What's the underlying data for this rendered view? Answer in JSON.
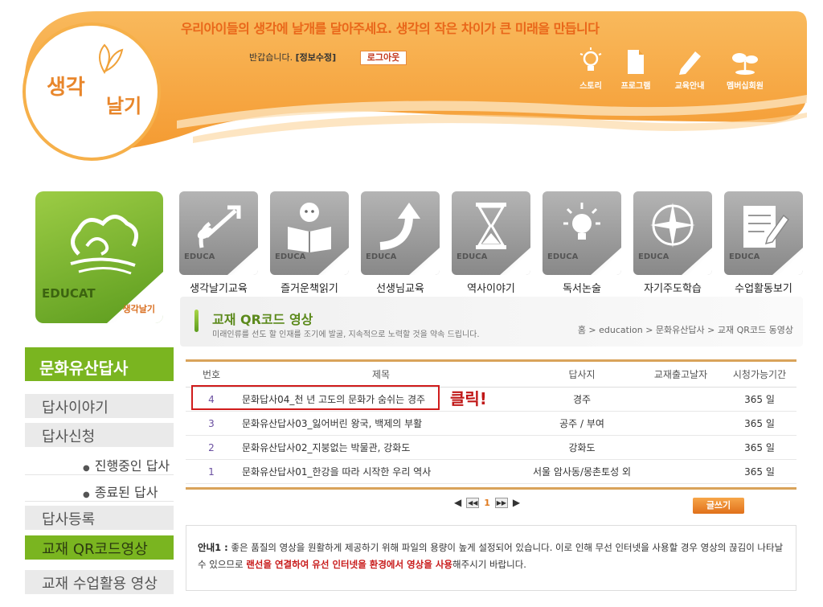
{
  "header": {
    "slogan": "우리아이들의 생각에 날개를 달아주세요. 생각의 작은 차이가 큰 미래을 만듭니다",
    "logo_text_1": "생각",
    "logo_text_2": "날기",
    "greeting": "반갑습니다.",
    "edit_info": "[정보수정]",
    "logout": "로그아웃",
    "nav": [
      {
        "label": "스토리",
        "icon": "lightbulb-icon"
      },
      {
        "label": "프로그램",
        "icon": "document-icon"
      },
      {
        "label": "교육안내",
        "icon": "pencil-icon"
      },
      {
        "label": "멤버십회원",
        "icon": "sprout-icon"
      }
    ]
  },
  "sidebar": {
    "card_label": "EDUCAT",
    "card_logo": "생각날기",
    "title": "문화유산답사",
    "items": [
      {
        "label": "답사이야기"
      },
      {
        "label": "답사신청"
      },
      {
        "label": "진행중인 답사"
      },
      {
        "label": "종료된 답사"
      },
      {
        "label": "답사등록"
      },
      {
        "label": "교재 QR코드영상"
      },
      {
        "label": "교재 수업활용 영상"
      }
    ]
  },
  "categories": [
    {
      "label": "생각날기교육",
      "tile_text": "EDUCA",
      "icon": "plant-arrow-icon"
    },
    {
      "label": "즐거운책읽기",
      "tile_text": "EDUCA",
      "icon": "reading-child-icon"
    },
    {
      "label": "선생님교육",
      "tile_text": "EDUCA",
      "icon": "curved-arrow-icon"
    },
    {
      "label": "역사이야기",
      "tile_text": "EDUCA",
      "icon": "hourglass-icon"
    },
    {
      "label": "독서논술",
      "tile_text": "EDUCA",
      "icon": "bulb-rays-icon"
    },
    {
      "label": "자기주도학습",
      "tile_text": "EDUCA",
      "icon": "compass-icon"
    },
    {
      "label": "수업활동보기",
      "tile_text": "EDUCA",
      "icon": "notepad-pencil-icon"
    }
  ],
  "titlebar": {
    "title": "교재 QR코드 영상",
    "subtitle": "미래인류를 선도 할 인재를 조기에 발굴, 지속적으로 노력할 것을 약속 드립니다.",
    "breadcrumb": "홈 > education > 문화유산답사 > 교재 QR코드 동영상"
  },
  "table": {
    "headers": {
      "no": "번호",
      "title": "제목",
      "place": "답사지",
      "date": "교재출고날자",
      "period": "시청가능기간"
    },
    "rows": [
      {
        "no": "4",
        "title": "문화답사04_천 년 고도의 문화가 숨쉬는 경주",
        "place": "경주",
        "date": "",
        "period": "365 일"
      },
      {
        "no": "3",
        "title": "문화유산답사03_잃어버린 왕국, 백제의 부활",
        "place": "공주 / 부여",
        "date": "",
        "period": "365 일"
      },
      {
        "no": "2",
        "title": "문화유산답사02_지붕없는 박물관, 강화도",
        "place": "강화도",
        "date": "",
        "period": "365 일"
      },
      {
        "no": "1",
        "title": "문화유산답사01_한강을 따라 시작한 우리 역사",
        "place": "서울 암사동/몽촌토성 외",
        "date": "",
        "period": "365 일"
      }
    ],
    "click_annotation": "클릭!"
  },
  "pager": {
    "current": "1"
  },
  "write_button": "글쓰기",
  "notice": {
    "label": "안내1 :",
    "text1": "좋은 품질의 영상을 원활하게 제공하기 위해 파일의 용량이 높게 설정되어 있습니다. 이로 인해 무선 인터넷을 사용할 경우 영상의 끊김이 나타날 수 있으므로",
    "highlight": "랜선을 연결하여 유선 인터넷을 환경에서 영상을 사용",
    "text2": "해주시기 바랍니다."
  },
  "colors": {
    "accent_orange": "#f7a84a",
    "accent_green": "#7ab520",
    "alert_red": "#c81a1a"
  }
}
